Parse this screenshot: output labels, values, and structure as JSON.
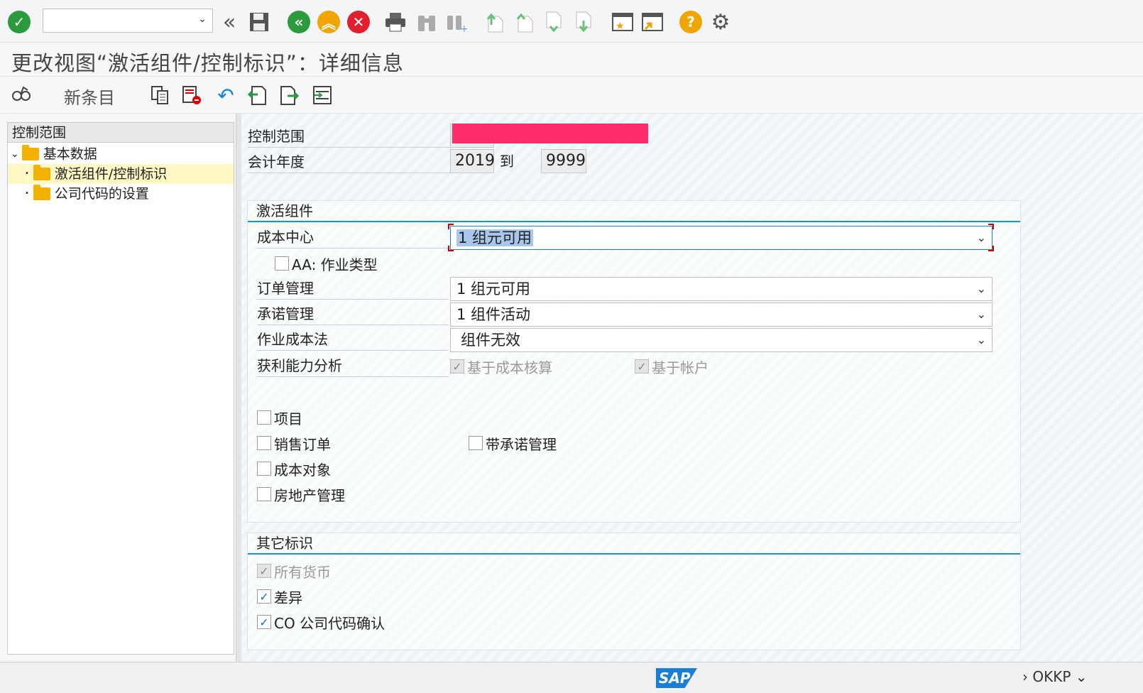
{
  "toolbar": {
    "command_field_value": "",
    "icons": [
      "enter-icon",
      "back-double-icon",
      "save-icon",
      "back-icon",
      "exit-icon",
      "cancel-icon",
      "print-icon",
      "find-icon",
      "find-next-icon",
      "first-page-icon",
      "previous-page-icon",
      "next-page-icon",
      "last-page-icon",
      "create-session-icon",
      "shortcut-icon",
      "help-icon",
      "settings-icon"
    ]
  },
  "title": "更改视图“激活组件/控制标识”：详细信息",
  "app_toolbar": {
    "new_entries_label": "新条目"
  },
  "tree": {
    "header": "控制范围",
    "items": [
      {
        "label": "基本数据",
        "level": 0,
        "expanded": true
      },
      {
        "label": "激活组件/控制标识",
        "level": 1,
        "selected": true
      },
      {
        "label": "公司代码的设置",
        "level": 1
      }
    ]
  },
  "form": {
    "controlling_area_label": "控制范围",
    "fiscal_year_label": "会计年度",
    "fiscal_year_from": "2019",
    "to_label": "到",
    "fiscal_year_to": "9999"
  },
  "activate_group": {
    "title": "激活组件",
    "cost_center_label": "成本中心",
    "cost_center_value": "1 组元可用",
    "aa_activity_type_label": "AA: 作业类型",
    "order_mgmt_label": "订单管理",
    "order_mgmt_value": "1 组元可用",
    "commitment_mgmt_label": "承诺管理",
    "commitment_mgmt_value": "1 组件活动",
    "abc_label": "作业成本法",
    "abc_value": "组件无效",
    "profitability_label": "获利能力分析",
    "costing_based_label": "基于成本核算",
    "account_based_label": "基于帐户",
    "projects_label": "项目",
    "sales_orders_label": "销售订单",
    "with_commitment_label": "带承诺管理",
    "cost_objects_label": "成本对象",
    "real_estate_label": "房地产管理"
  },
  "other_group": {
    "title": "其它标识",
    "all_currencies_label": "所有货币",
    "variances_label": "差异",
    "co_cc_validation_label": "CO 公司代码确认"
  },
  "status": {
    "sap_logo": "SAP",
    "tcode": "OKKP"
  },
  "colors": {
    "accent": "#1a8fd6",
    "redaction": "#ff2d6b"
  }
}
